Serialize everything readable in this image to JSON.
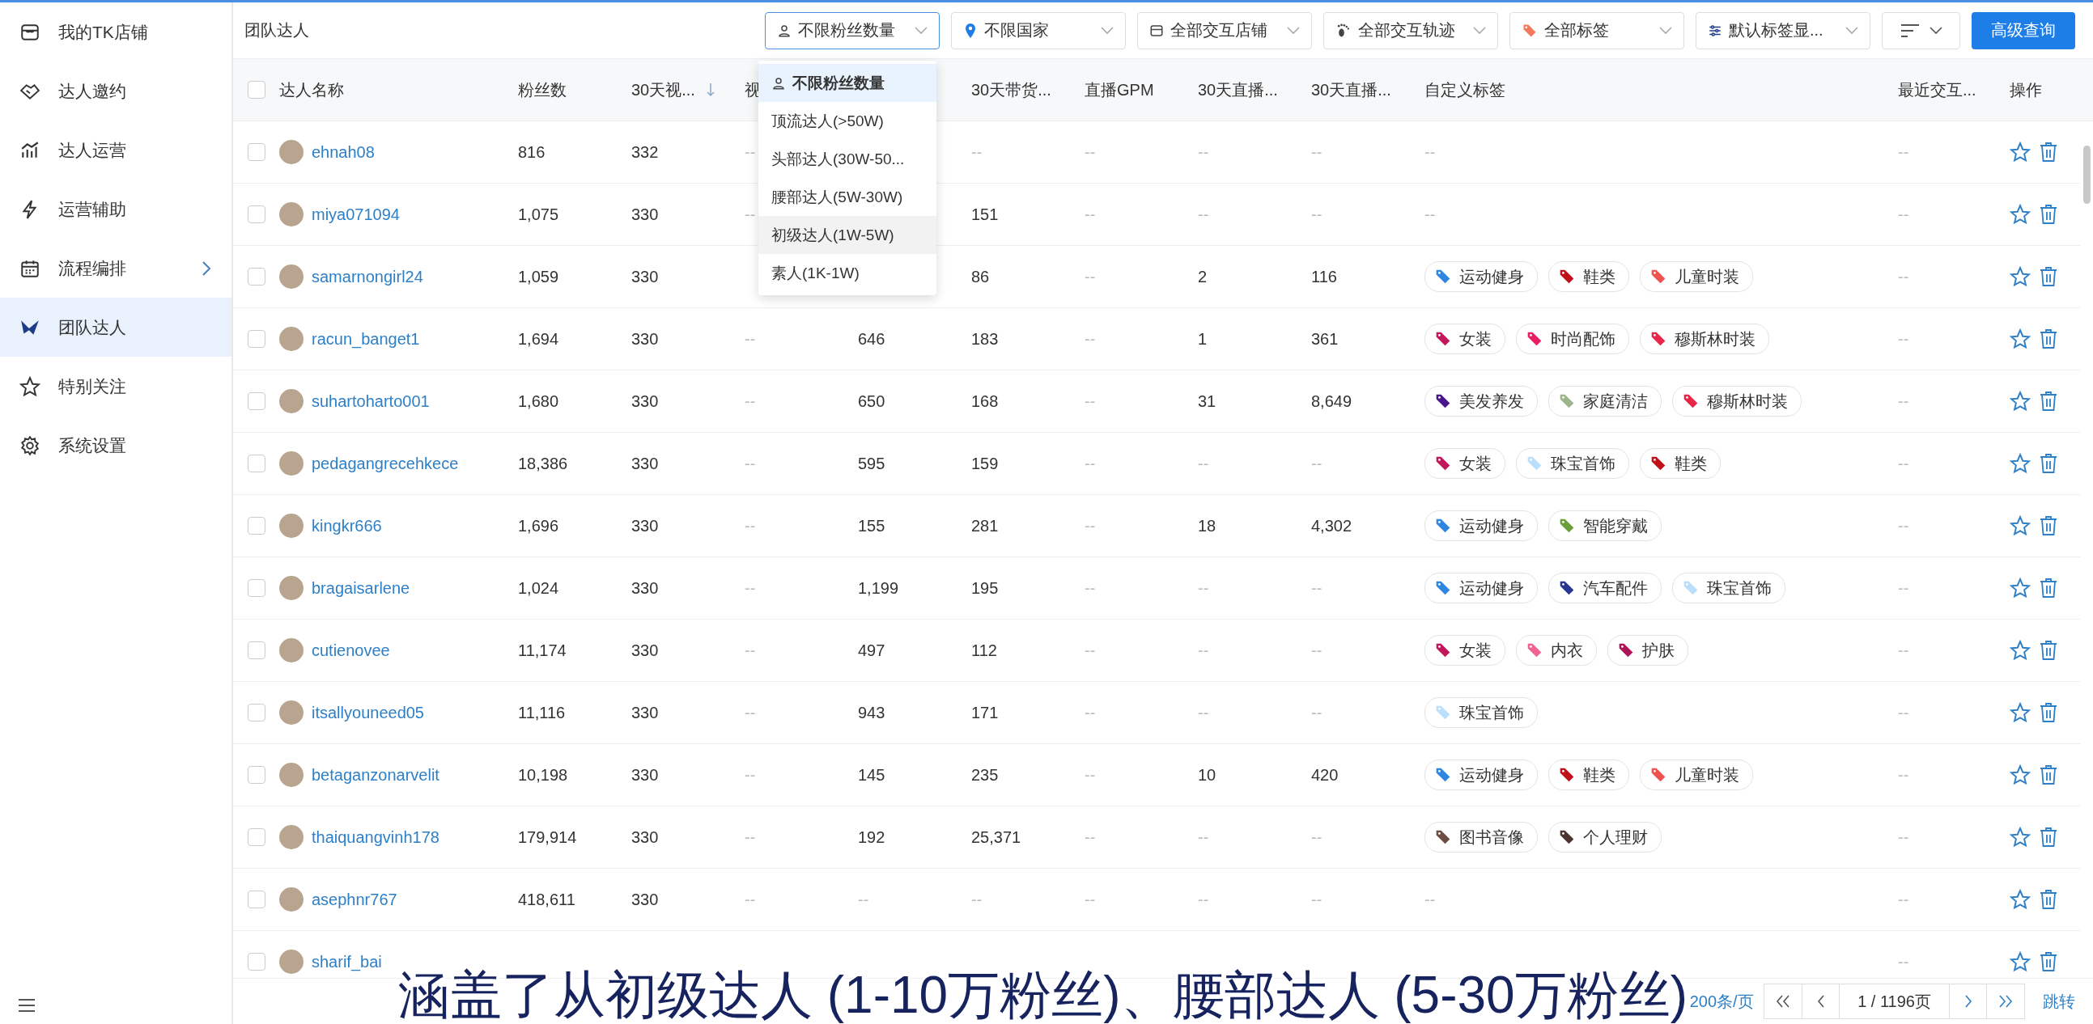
{
  "sidebar": {
    "items": [
      {
        "label": "我的TK店铺",
        "selected": false,
        "has_submenu": false
      },
      {
        "label": "达人邀约",
        "selected": false,
        "has_submenu": false
      },
      {
        "label": "达人运营",
        "selected": false,
        "has_submenu": false
      },
      {
        "label": "运营辅助",
        "selected": false,
        "has_submenu": false
      },
      {
        "label": "流程编排",
        "selected": false,
        "has_submenu": true
      },
      {
        "label": "团队达人",
        "selected": true,
        "has_submenu": false
      },
      {
        "label": "特别关注",
        "selected": false,
        "has_submenu": false
      },
      {
        "label": "系统设置",
        "selected": false,
        "has_submenu": false
      }
    ]
  },
  "toolbar": {
    "title": "团队达人",
    "filters": [
      {
        "label": "不限粉丝数量",
        "open": true
      },
      {
        "label": "不限国家",
        "open": false
      },
      {
        "label": "全部交互店铺",
        "open": false
      },
      {
        "label": "全部交互轨迹",
        "open": false
      },
      {
        "label": "全部标签",
        "open": false
      },
      {
        "label": "默认标签显...",
        "open": false
      }
    ],
    "advanced_button": "高级查询"
  },
  "fans_dropdown": {
    "options": [
      {
        "label": "不限粉丝数量",
        "selected": true,
        "hovered": false
      },
      {
        "label": "顶流达人(>50W)",
        "selected": false,
        "hovered": false
      },
      {
        "label": "头部达人(30W-50...",
        "selected": false,
        "hovered": false
      },
      {
        "label": "腰部达人(5W-30W)",
        "selected": false,
        "hovered": false
      },
      {
        "label": "初级达人(1W-5W)",
        "selected": false,
        "hovered": true
      },
      {
        "label": "素人(1K-1W)",
        "selected": false,
        "hovered": false
      }
    ]
  },
  "table": {
    "all_checked": false,
    "columns": [
      {
        "label": "达人名称"
      },
      {
        "label": "粉丝数"
      },
      {
        "label": "30天视...",
        "sorted_descending": true
      },
      {
        "label": "视"
      },
      {},
      {
        "label": "30天带货..."
      },
      {
        "label": "直播GPM"
      },
      {
        "label": "30天直播..."
      },
      {
        "label": "30天直播..."
      },
      {
        "label": "自定义标签"
      },
      {
        "label": "最近交互..."
      },
      {
        "label": "操作"
      }
    ],
    "rows": [
      {
        "checked": false,
        "cells": [
          "ehnah08",
          "816",
          "332",
          "--",
          null,
          "--",
          "--",
          "--",
          "--"
        ],
        "tags": [],
        "tags_empty": "--",
        "last": "--"
      },
      {
        "checked": false,
        "cells": [
          "miya071094",
          "1,075",
          "330",
          "--",
          null,
          "151",
          "--",
          "--",
          "--"
        ],
        "tags": [],
        "tags_empty": "--",
        "last": "--"
      },
      {
        "checked": false,
        "cells": [
          "samarnongirl24",
          "1,059",
          "330",
          null,
          null,
          "86",
          "--",
          "2",
          "116"
        ],
        "tags": [
          {
            "label": "运动健身",
            "color": "#2f86e0"
          },
          {
            "label": "鞋类",
            "color": "#c0101a"
          },
          {
            "label": "儿童时装",
            "color": "#ef5350"
          }
        ],
        "last": "--"
      },
      {
        "checked": false,
        "cells": [
          "racun_banget1",
          "1,694",
          "330",
          "--",
          "646",
          "183",
          "--",
          "1",
          "361"
        ],
        "tags": [
          {
            "label": "女装",
            "color": "#c2185b"
          },
          {
            "label": "时尚配饰",
            "color": "#e91e63"
          },
          {
            "label": "穆斯林时装",
            "color": "#e8264a"
          }
        ],
        "last": "--"
      },
      {
        "checked": false,
        "cells": [
          "suhartoharto001",
          "1,680",
          "330",
          "--",
          "650",
          "168",
          "--",
          "31",
          "8,649"
        ],
        "tags": [
          {
            "label": "美发养发",
            "color": "#4a148c"
          },
          {
            "label": "家庭清洁",
            "color": "#9cb58a"
          },
          {
            "label": "穆斯林时装",
            "color": "#e8264a"
          }
        ],
        "last": "--"
      },
      {
        "checked": false,
        "cells": [
          "pedagangrecehkece",
          "18,386",
          "330",
          "--",
          "595",
          "159",
          "--",
          "--",
          "--"
        ],
        "tags": [
          {
            "label": "女装",
            "color": "#c2185b"
          },
          {
            "label": "珠宝首饰",
            "color": "#bbdefb"
          },
          {
            "label": "鞋类",
            "color": "#c0101a"
          }
        ],
        "last": "--"
      },
      {
        "checked": false,
        "cells": [
          "kingkr666",
          "1,696",
          "330",
          "--",
          "155",
          "281",
          "--",
          "18",
          "4,302"
        ],
        "tags": [
          {
            "label": "运动健身",
            "color": "#2f86e0"
          },
          {
            "label": "智能穿戴",
            "color": "#6a9f3a"
          }
        ],
        "last": "--"
      },
      {
        "checked": false,
        "cells": [
          "bragaisarlene",
          "1,024",
          "330",
          "--",
          "1,199",
          "195",
          "--",
          "--",
          "--"
        ],
        "tags": [
          {
            "label": "运动健身",
            "color": "#2f86e0"
          },
          {
            "label": "汽车配件",
            "color": "#283593"
          },
          {
            "label": "珠宝首饰",
            "color": "#bbdefb"
          }
        ],
        "last": "--"
      },
      {
        "checked": false,
        "cells": [
          "cutienovee",
          "11,174",
          "330",
          "--",
          "497",
          "112",
          "--",
          "--",
          "--"
        ],
        "tags": [
          {
            "label": "女装",
            "color": "#c2185b"
          },
          {
            "label": "内衣",
            "color": "#f06292"
          },
          {
            "label": "护肤",
            "color": "#ad1457"
          }
        ],
        "last": "--"
      },
      {
        "checked": false,
        "cells": [
          "itsallyouneed05",
          "11,116",
          "330",
          "--",
          "943",
          "171",
          "--",
          "--",
          "--"
        ],
        "tags": [
          {
            "label": "珠宝首饰",
            "color": "#bbdefb"
          }
        ],
        "last": "--"
      },
      {
        "checked": false,
        "cells": [
          "betaganzonarvelit",
          "10,198",
          "330",
          "--",
          "145",
          "235",
          "--",
          "10",
          "420"
        ],
        "tags": [
          {
            "label": "运动健身",
            "color": "#2f86e0"
          },
          {
            "label": "鞋类",
            "color": "#c0101a"
          },
          {
            "label": "儿童时装",
            "color": "#ef5350"
          }
        ],
        "last": "--"
      },
      {
        "checked": false,
        "cells": [
          "thaiquangvinh178",
          "179,914",
          "330",
          "--",
          "192",
          "25,371",
          "--",
          "--",
          "--"
        ],
        "tags": [
          {
            "label": "图书音像",
            "color": "#6d4c41"
          },
          {
            "label": "个人理财",
            "color": "#4e342e"
          }
        ],
        "last": "--"
      },
      {
        "checked": false,
        "cells": [
          "asephnr767",
          "418,611",
          "330",
          "--",
          "--",
          "--",
          "--",
          "--",
          "--"
        ],
        "tags": [],
        "tags_empty": "--",
        "last": "--"
      },
      {
        "checked": false,
        "cells": [
          "sharif_bai",
          null,
          null,
          null,
          null,
          null,
          null,
          null,
          null
        ],
        "tags": [],
        "last": "--"
      }
    ]
  },
  "pagination": {
    "page_size": "200条/页",
    "page": "1 / 1196页",
    "jump": "跳转"
  },
  "subtitle": "涵盖了从初级达人 (1-10万粉丝)、腰部达人 (5-30万粉丝)"
}
